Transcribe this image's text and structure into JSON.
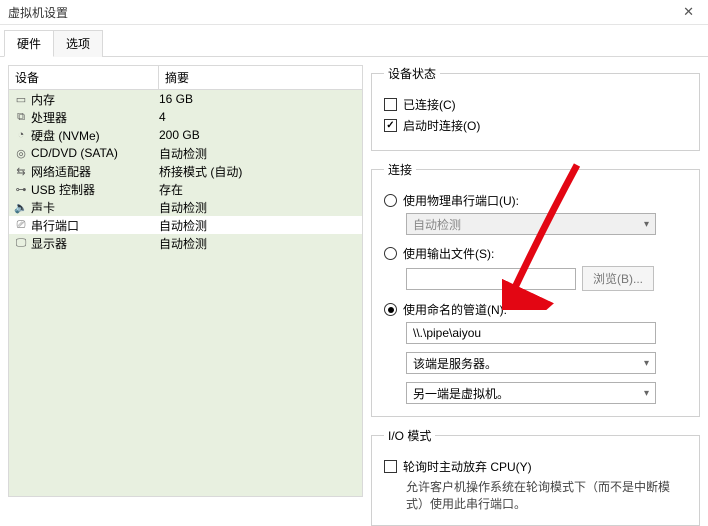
{
  "window": {
    "title": "虚拟机设置"
  },
  "tabs": {
    "hardware": "硬件",
    "options": "选项"
  },
  "table": {
    "header_device": "设备",
    "header_summary": "摘要",
    "rows": [
      {
        "icon": "memory-icon",
        "glyph": "▭",
        "device": "内存",
        "summary": "16 GB",
        "selected": false
      },
      {
        "icon": "cpu-icon",
        "glyph": "⧉",
        "device": "处理器",
        "summary": "4",
        "selected": false
      },
      {
        "icon": "disk-icon",
        "glyph": "◔",
        "device": "硬盘 (NVMe)",
        "summary": "200 GB",
        "selected": false
      },
      {
        "icon": "optical-icon",
        "glyph": "◎",
        "device": "CD/DVD (SATA)",
        "summary": "自动检测",
        "selected": false
      },
      {
        "icon": "network-icon",
        "glyph": "⇆",
        "device": "网络适配器",
        "summary": "桥接模式 (自动)",
        "selected": false
      },
      {
        "icon": "usb-icon",
        "glyph": "⊶",
        "device": "USB 控制器",
        "summary": "存在",
        "selected": false
      },
      {
        "icon": "sound-icon",
        "glyph": "🔈",
        "device": "声卡",
        "summary": "自动检测",
        "selected": false
      },
      {
        "icon": "serial-icon",
        "glyph": "⎚",
        "device": "串行端口",
        "summary": "自动检测",
        "selected": true
      },
      {
        "icon": "display-icon",
        "glyph": "🖵",
        "device": "显示器",
        "summary": "自动检测",
        "selected": false
      }
    ]
  },
  "device_status": {
    "legend": "设备状态",
    "connected": {
      "label": "已连接(C)",
      "checked": false
    },
    "connect_on_poweron": {
      "label": "启动时连接(O)",
      "checked": true
    }
  },
  "connection": {
    "legend": "连接",
    "physical": {
      "label": "使用物理串行端口(U):",
      "checked": false,
      "select": "自动检测"
    },
    "output_file": {
      "label": "使用输出文件(S):",
      "checked": false,
      "value": "",
      "browse": "浏览(B)..."
    },
    "named_pipe": {
      "label": "使用命名的管道(N):",
      "checked": true,
      "value": "\\\\.\\pipe\\aiyou",
      "end1": "该端是服务器。",
      "end2": "另一端是虚拟机。"
    }
  },
  "io_mode": {
    "legend": "I/O 模式",
    "yield": {
      "label": "轮询时主动放弃 CPU(Y)",
      "checked": false
    },
    "help": "允许客户机操作系统在轮询模式下（而不是中断模式）使用此串行端口。"
  }
}
